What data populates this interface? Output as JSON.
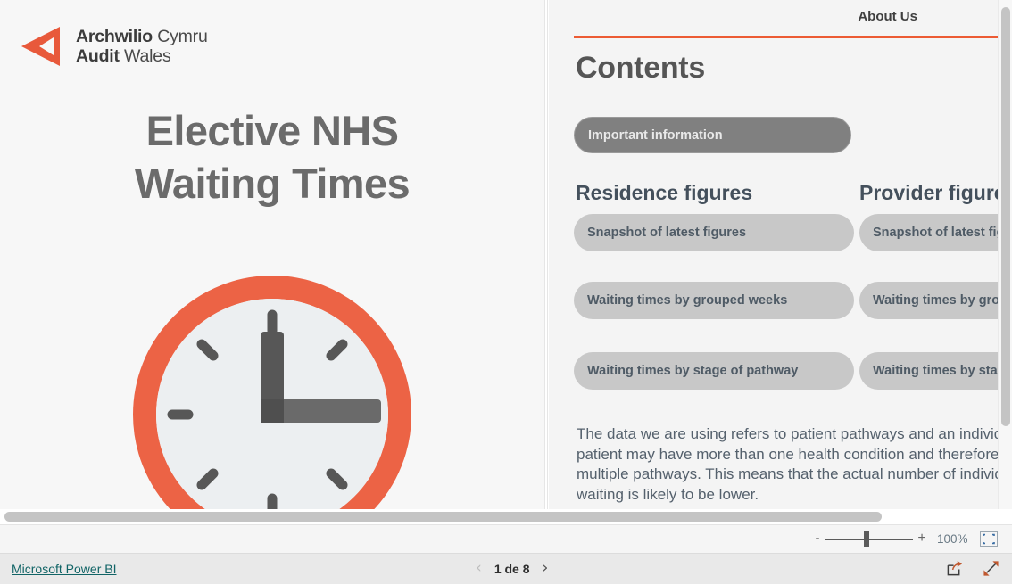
{
  "brand": {
    "line1_bold": "Archwilio",
    "line1_light": "Cymru",
    "line2_bold": "Audit",
    "line2_light": "Wales",
    "logo_icon": "triangle-play-left-icon",
    "accent_color": "#e8593b"
  },
  "cover": {
    "title_line1": "Elective NHS",
    "title_line2": "Waiting Times",
    "clock_icon": "clock-icon",
    "clock_ring_color": "#ec6345",
    "clock_face_color": "#eceff1",
    "clock_hand_color": "#575757"
  },
  "contents": {
    "about_us_label": "About Us",
    "heading": "Contents",
    "rule_color": "#ec5b34",
    "important_button": "Important information",
    "columns": [
      {
        "heading": "Residence figures",
        "buttons": [
          "Snapshot of latest figures",
          "Waiting times by grouped weeks",
          "Waiting times by stage of pathway"
        ]
      },
      {
        "heading": "Provider figures",
        "buttons": [
          "Snapshot of latest figures",
          "Waiting times by grouped weeks",
          "Waiting times by stage of pathway"
        ]
      }
    ],
    "note_line1": "The data we are using refers to patient pathways and an individual",
    "note_line2": "patient may have more than one health condition and therefore",
    "note_line3": "multiple pathways. This means that the actual number of individuals",
    "note_line4": "waiting is likely to be lower."
  },
  "zoombar": {
    "minus_label": "-",
    "plus_label": "+",
    "zoom_level": "100%",
    "fit_icon": "fit-to-page-icon"
  },
  "statusbar": {
    "powerbi_link": "Microsoft Power BI",
    "prev_icon": "chevron-left-icon",
    "next_icon": "chevron-right-icon",
    "prev_glyph": "‹",
    "next_glyph": "›",
    "page_label": "1 de 8",
    "share_icon": "share-icon",
    "fullscreen_icon": "fullscreen-icon"
  }
}
